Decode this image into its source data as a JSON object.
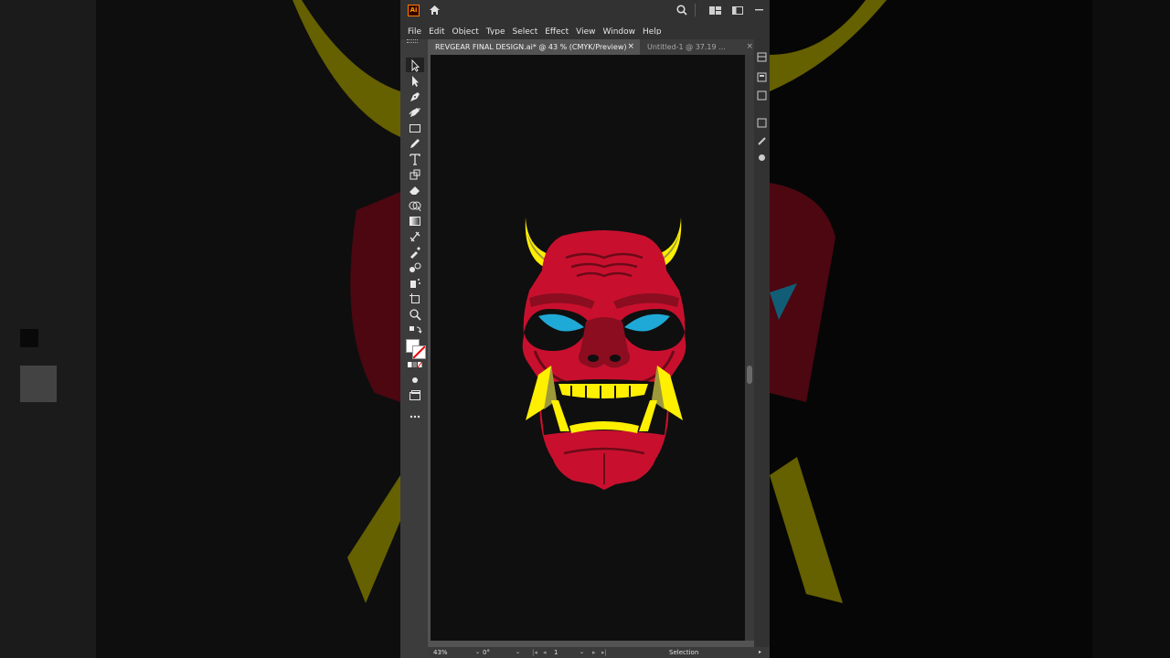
{
  "app": {
    "logo": "Ai"
  },
  "menu": [
    "File",
    "Edit",
    "Object",
    "Type",
    "Select",
    "Effect",
    "View",
    "Window",
    "Help"
  ],
  "tabs": [
    {
      "label": "REVGEAR FINAL DESIGN.ai* @ 43 % (CMYK/Preview)",
      "close": "×"
    },
    {
      "label": "Untitled-1 @ 37.19 ...",
      "close": "×"
    }
  ],
  "status": {
    "zoom": "43%",
    "rotation": "0°",
    "artboard": "1",
    "tool": "Selection"
  },
  "colors": {
    "mask_red": "#c8102e",
    "mask_dark": "#8b0d1f",
    "horn_yellow": "#ffef00",
    "horn_olive": "#9e9a3a",
    "eye_blue": "#1fa9d6"
  },
  "icons": [
    "home-icon",
    "search-icon",
    "arrange-documents-icon",
    "workspace-icon",
    "minimize-icon",
    "selection-tool-icon",
    "direct-selection-tool-icon",
    "pen-tool-icon",
    "curvature-tool-icon",
    "rectangle-tool-icon",
    "pencil-tool-icon",
    "type-tool-icon",
    "rotate-tool-icon",
    "eraser-tool-icon",
    "shape-builder-tool-icon",
    "gradient-tool-icon",
    "eyedropper-tool-icon",
    "blend-tool-icon",
    "symbol-sprayer-icon",
    "artboard-tool-icon",
    "zoom-tool-icon",
    "fill-stroke-icon",
    "more-tools-icon"
  ]
}
